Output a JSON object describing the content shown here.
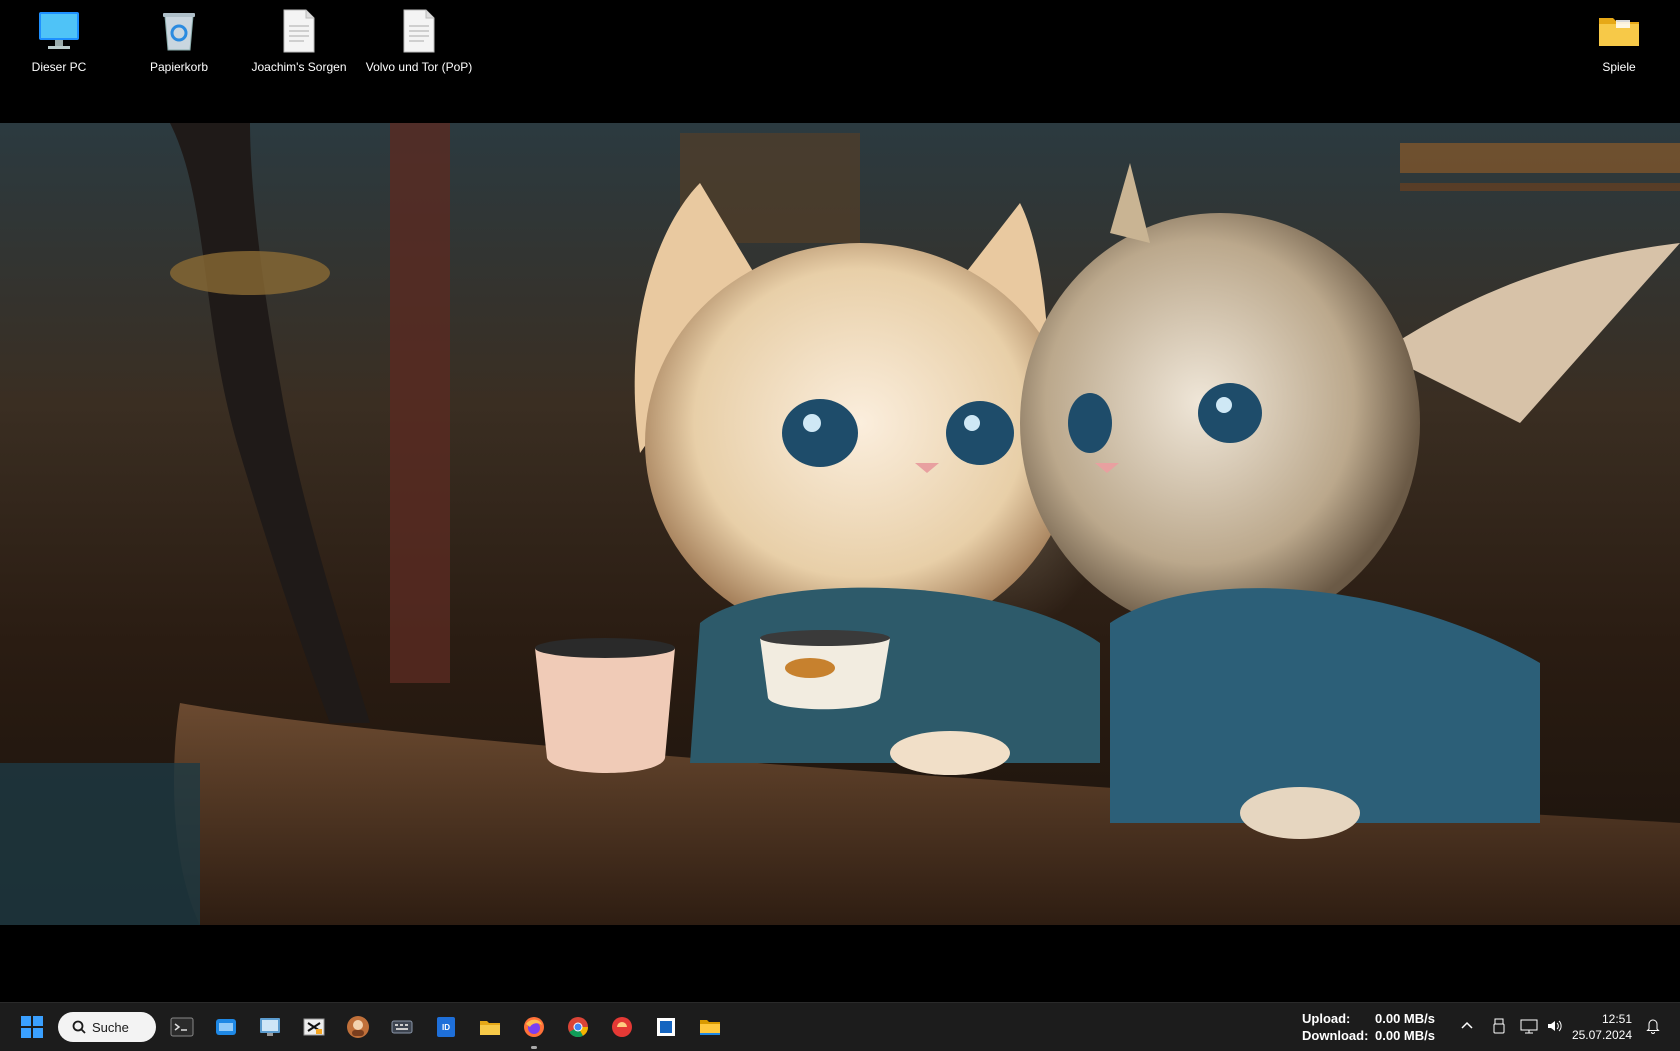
{
  "desktop": {
    "icons": [
      {
        "label": "Dieser PC",
        "icon": "monitor-icon"
      },
      {
        "label": "Papierkorb",
        "icon": "recycle-bin-icon"
      },
      {
        "label": "Joachim's Sorgen",
        "icon": "text-document-icon"
      },
      {
        "label": "Volvo und Tor (PoP)",
        "icon": "text-document-icon"
      },
      {
        "label": "Spiele",
        "icon": "folder-icon"
      }
    ]
  },
  "wallpaper": {
    "subject": "cat-pirates-with-teacups"
  },
  "taskbar": {
    "search_label": "Suche",
    "apps": [
      {
        "icon": "terminal-icon"
      },
      {
        "icon": "app-window-icon"
      },
      {
        "icon": "remote-desktop-icon"
      },
      {
        "icon": "tool-icon"
      },
      {
        "icon": "avatar-app-icon"
      },
      {
        "icon": "keyboard-icon"
      },
      {
        "icon": "id-app-icon"
      },
      {
        "icon": "file-explorer-icon"
      },
      {
        "icon": "firefox-icon"
      },
      {
        "icon": "chrome-icon"
      },
      {
        "icon": "red-circle-app-icon"
      },
      {
        "icon": "window-app-icon"
      },
      {
        "icon": "folder-icon"
      }
    ],
    "network": {
      "upload_label": "Upload:",
      "upload_value": "0.00 MB/s",
      "download_label": "Download:",
      "download_value": "0.00 MB/s"
    },
    "clock": {
      "time": "12:51",
      "date": "25.07.2024"
    }
  },
  "colors": {
    "taskbar": "#1c1c1c",
    "accent": "#0078d4"
  }
}
